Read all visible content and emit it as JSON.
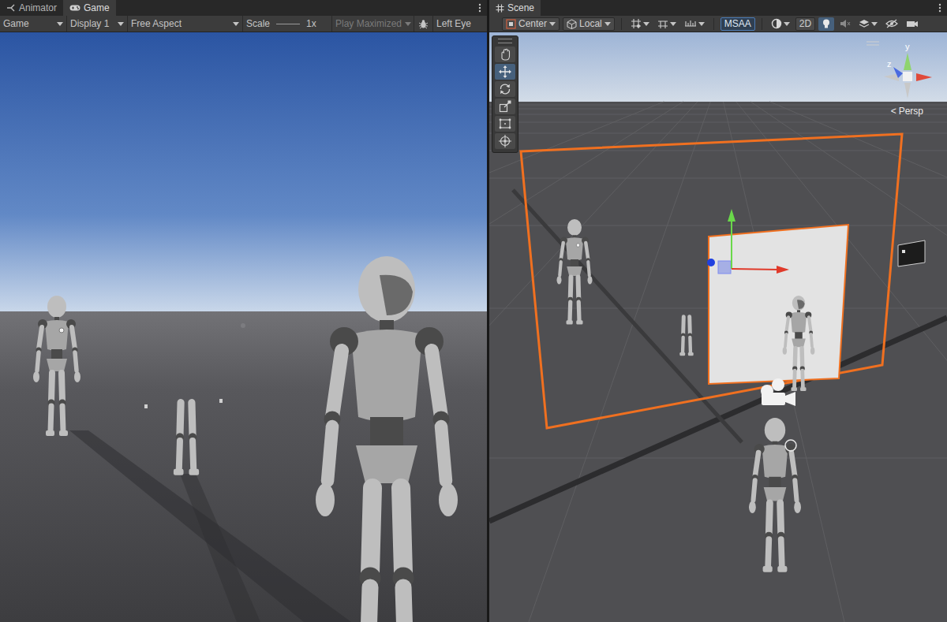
{
  "game_panel": {
    "tabs": [
      {
        "label": "Animator",
        "selected": false
      },
      {
        "label": "Game",
        "selected": true
      }
    ],
    "toolbar": {
      "view": "Game",
      "display": "Display 1",
      "aspect": "Free Aspect",
      "scale_label": "Scale",
      "scale_value": "1x",
      "play_mode": {
        "label": "Play Maximized",
        "disabled": true
      },
      "eye": "Left Eye"
    }
  },
  "scene_panel": {
    "tabs": [
      {
        "label": "Scene",
        "selected": true
      }
    ],
    "toolbar": {
      "pivot": "Center",
      "space": "Local",
      "msaa": {
        "label": "MSAA",
        "on": true
      },
      "view_2d": {
        "label": "2D",
        "on": false
      },
      "lighting": {
        "on": true
      }
    },
    "tools": [
      {
        "kind": "hand",
        "selected": false
      },
      {
        "kind": "move",
        "selected": true
      },
      {
        "kind": "rotate",
        "selected": false
      },
      {
        "kind": "scale",
        "selected": false
      },
      {
        "kind": "rect",
        "selected": false
      },
      {
        "kind": "transform",
        "selected": false
      }
    ],
    "gizmo": {
      "axes": [
        {
          "label": "y"
        },
        {
          "label": "z"
        }
      ],
      "projection_arrow": "<",
      "projection": "Persp"
    }
  }
}
